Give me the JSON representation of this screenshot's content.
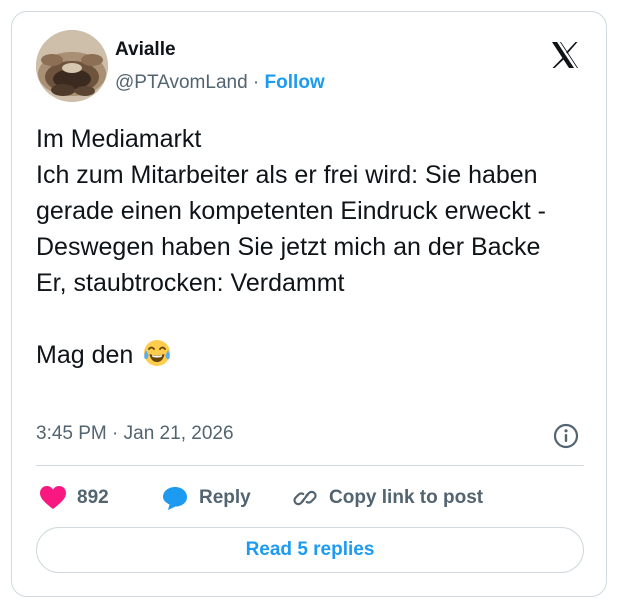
{
  "author": {
    "name": "Avialle",
    "handle": "@PTAvomLand",
    "separator": " · ",
    "follow_label": "Follow"
  },
  "tweet": {
    "text": "Im Mediamarkt\nIch zum Mitarbeiter als er frei wird: Sie haben gerade einen kompetenten Eindruck erweckt - Deswegen haben Sie jetzt mich an der Backe\nEr, staubtrocken: Verdammt\n\nMag den",
    "emoji": "face-with-tears-of-joy",
    "timestamp": "3:45 PM · Jan 21, 2026"
  },
  "actions": {
    "like_count": "892",
    "reply_label": "Reply",
    "copy_link_label": "Copy link to post"
  },
  "read_replies_label": "Read 5 replies",
  "colors": {
    "accent": "#1d9bf0",
    "like": "#f91880",
    "secondary_text": "#536471",
    "border": "#cfd9de"
  },
  "icons": [
    "x-logo-icon",
    "info-icon",
    "heart-icon",
    "reply-bubble-icon",
    "link-icon"
  ]
}
